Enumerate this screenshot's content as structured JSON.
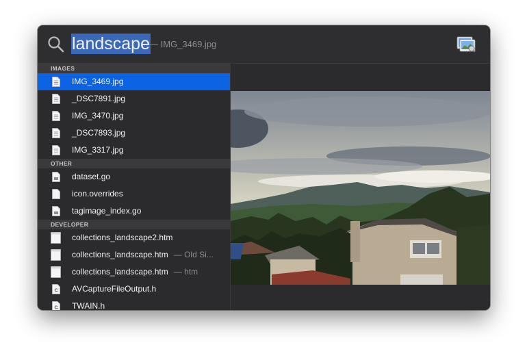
{
  "search": {
    "query": "landscape",
    "completion": "— IMG_3469.jpg"
  },
  "sections": [
    {
      "title": "IMAGES",
      "items": [
        {
          "label": "IMG_3469.jpg",
          "detail": "",
          "icon": "image-file-icon",
          "selected": true
        },
        {
          "label": "_DSC7891.jpg",
          "detail": "",
          "icon": "image-file-icon"
        },
        {
          "label": "IMG_3470.jpg",
          "detail": "",
          "icon": "image-file-icon"
        },
        {
          "label": "_DSC7893.jpg",
          "detail": "",
          "icon": "image-file-icon"
        },
        {
          "label": "IMG_3317.jpg",
          "detail": "",
          "icon": "image-file-icon"
        }
      ]
    },
    {
      "title": "OTHER",
      "items": [
        {
          "label": "dataset.go",
          "detail": "",
          "icon": "source-file-icon"
        },
        {
          "label": "icon.overrides",
          "detail": "",
          "icon": "blank-file-icon"
        },
        {
          "label": "tagimage_index.go",
          "detail": "",
          "icon": "source-file-icon"
        }
      ]
    },
    {
      "title": "DEVELOPER",
      "items": [
        {
          "label": "collections_landscape2.htm",
          "detail": "",
          "icon": "html-document-icon"
        },
        {
          "label": "collections_landscape.htm",
          "detail": "— Old Si...",
          "icon": "html-document-icon"
        },
        {
          "label": "collections_landscape.htm",
          "detail": "— htm",
          "icon": "html-document-icon"
        },
        {
          "label": "AVCaptureFileOutput.h",
          "detail": "",
          "icon": "c-header-file-icon"
        },
        {
          "label": "TWAIN.h",
          "detail": "",
          "icon": "c-header-file-icon"
        }
      ]
    }
  ],
  "icons": {
    "search": "search-icon",
    "preview_app": "preview-app-icon"
  },
  "colors": {
    "selection": "#0b63e3",
    "query_highlight": "#3b69b9",
    "window_bg": "#2b2b2d",
    "section_header_bg": "#3a3a3d"
  }
}
